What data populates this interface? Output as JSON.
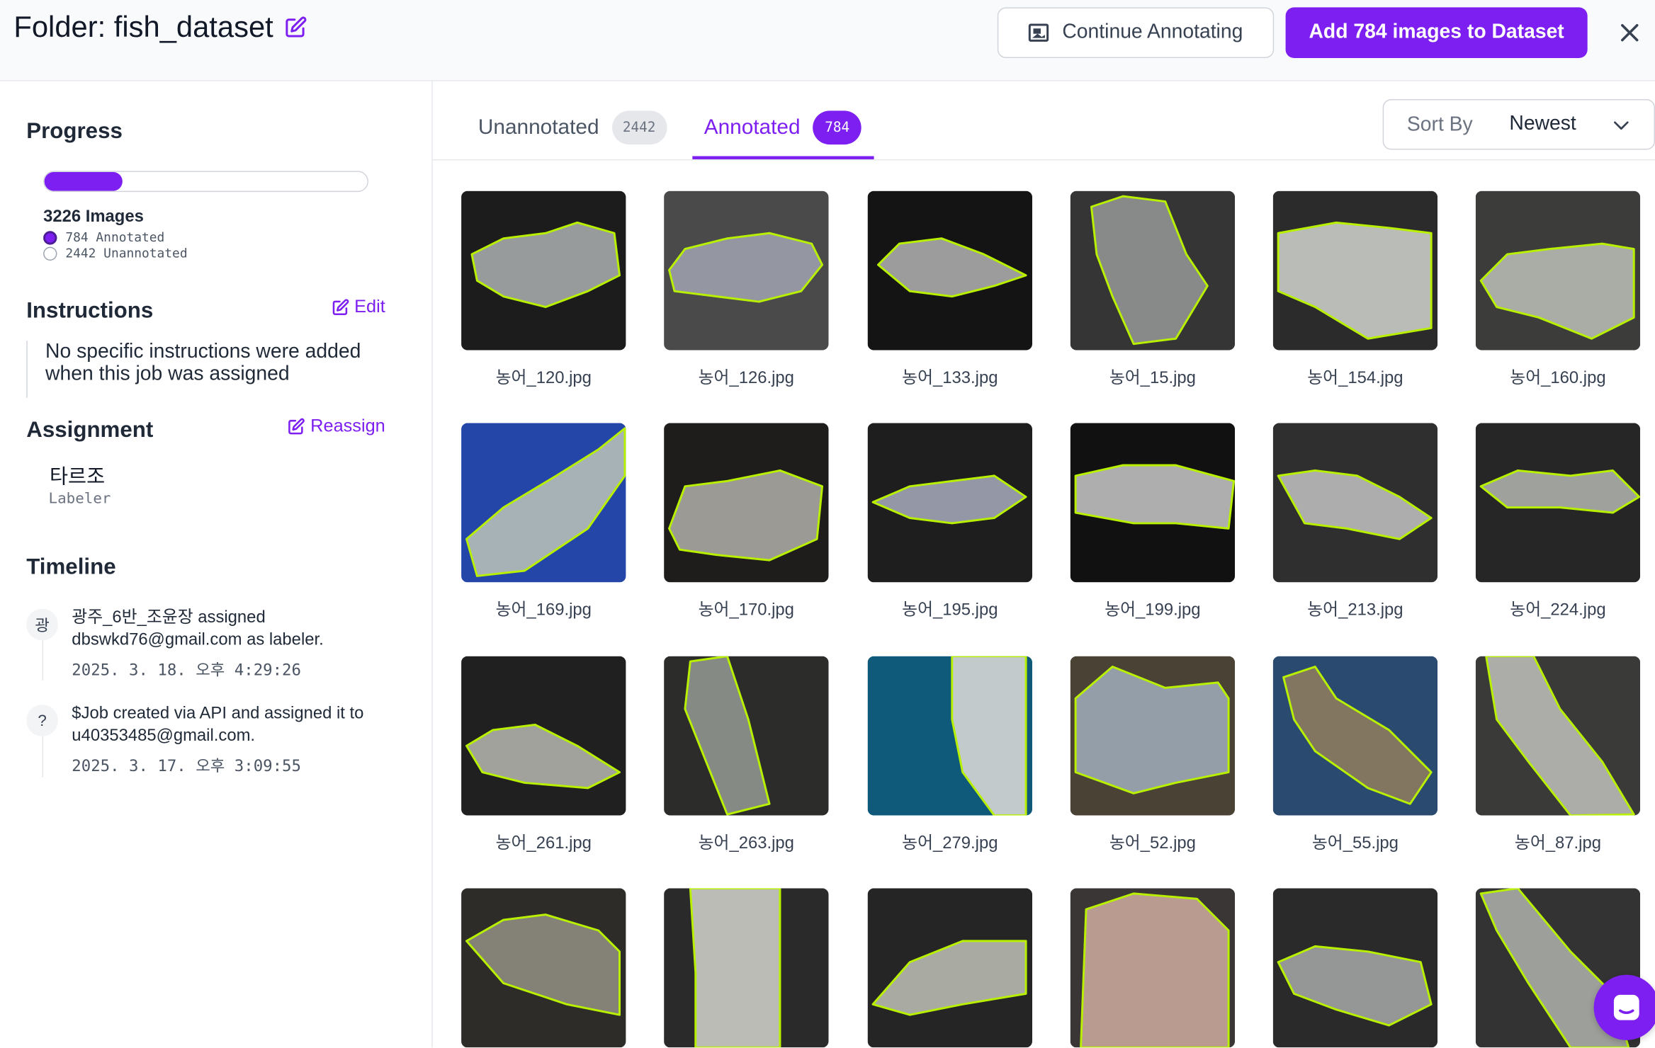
{
  "header": {
    "folder_title": "Folder: fish_dataset",
    "continue_label": "Continue Annotating",
    "add_label": "Add 784 images to Dataset"
  },
  "sidebar": {
    "progress_title": "Progress",
    "progress_fraction": 0.243,
    "images_total": "3226 Images",
    "annotated_text": "784 Annotated",
    "unannotated_text": "2442 Unannotated",
    "instructions_title": "Instructions",
    "edit_label": "Edit",
    "instructions_text": "No specific instructions were added when this job was assigned",
    "assignment_title": "Assignment",
    "reassign_label": "Reassign",
    "assignee_name": "타르조",
    "assignee_role": "Labeler",
    "timeline_title": "Timeline",
    "timeline": [
      {
        "avatar": "광",
        "text": "광주_6반_조윤장 assigned dbswkd76@gmail.com as labeler.",
        "time": "2025. 3. 18. 오후 4:29:26"
      },
      {
        "avatar": "?",
        "text": "$Job created via API and assigned it to u40353485@gmail.com.",
        "time": "2025. 3. 17. 오후 3:09:55"
      }
    ]
  },
  "tabs": {
    "unannotated_label": "Unannotated",
    "unannotated_count": "2442",
    "annotated_label": "Annotated",
    "annotated_count": "784"
  },
  "sort": {
    "label": "Sort By",
    "value": "Newest"
  },
  "images": [
    {
      "name": "농어_120.jpg",
      "bg": "#1c1c1c",
      "fish": "#a3a6a6"
    },
    {
      "name": "농어_126.jpg",
      "bg": "#4a4a4a",
      "fish": "#9a9ca8"
    },
    {
      "name": "농어_133.jpg",
      "bg": "#141414",
      "fish": "#a8a8a8"
    },
    {
      "name": "농어_15.jpg",
      "bg": "#353535",
      "fish": "#8f9090"
    },
    {
      "name": "농어_154.jpg",
      "bg": "#2b2b2b",
      "fish": "#c7c9c4"
    },
    {
      "name": "농어_160.jpg",
      "bg": "#3c3c3a",
      "fish": "#b4b6b0"
    },
    {
      "name": "농어_169.jpg",
      "bg": "#2446a8",
      "fish": "#b2bcb6"
    },
    {
      "name": "농어_170.jpg",
      "bg": "#1f1d1b",
      "fish": "#a6a59e"
    },
    {
      "name": "농어_195.jpg",
      "bg": "#1e1e1e",
      "fish": "#9ea2b2"
    },
    {
      "name": "농어_199.jpg",
      "bg": "#111111",
      "fish": "#bcbcbc"
    },
    {
      "name": "농어_213.jpg",
      "bg": "#2f2f2f",
      "fish": "#b8b8b8"
    },
    {
      "name": "농어_224.jpg",
      "bg": "#262626",
      "fish": "#a9aca6"
    },
    {
      "name": "농어_261.jpg",
      "bg": "#202020",
      "fish": "#adaea6"
    },
    {
      "name": "농어_263.jpg",
      "bg": "#2c2c2a",
      "fish": "#8e938c"
    },
    {
      "name": "농어_279.jpg",
      "bg": "#0f5a7a",
      "fish": "#d2d4d3"
    },
    {
      "name": "농어_52.jpg",
      "bg": "#4a4234",
      "fish": "#9aa6b2"
    },
    {
      "name": "농어_55.jpg",
      "bg": "#2a4a70",
      "fish": "#8a7a5e"
    },
    {
      "name": "농어_87.jpg",
      "bg": "#3a3a38",
      "fish": "#b6b6b2"
    },
    {
      "name": "",
      "bg": "#2e2c28",
      "fish": "#8c8a7e"
    },
    {
      "name": "",
      "bg": "#2a2a2a",
      "fish": "#c8c9c2"
    },
    {
      "name": "",
      "bg": "#252525",
      "fish": "#b4b6ae"
    },
    {
      "name": "",
      "bg": "#3a3636",
      "fish": "#c6a498"
    },
    {
      "name": "",
      "bg": "#2a2a2a",
      "fish": "#9ea0a0"
    },
    {
      "name": "",
      "bg": "#333333",
      "fish": "#a6a8a4"
    }
  ],
  "colors": {
    "accent": "#7c1ff0",
    "polygon": "#b8f000"
  }
}
